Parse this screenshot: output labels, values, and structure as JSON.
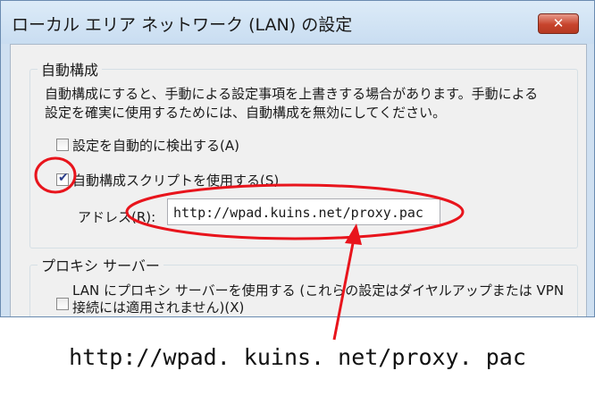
{
  "window": {
    "title": "ローカル エリア ネットワーク (LAN) の設定",
    "close_glyph": "✕"
  },
  "auto_config": {
    "legend": "自動構成",
    "description_line1": "自動構成にすると、手動による設定事項を上書きする場合があります。手動による",
    "description_line2": "設定を確実に使用するためには、自動構成を無効にしてください。",
    "auto_detect": {
      "label": "設定を自動的に検出する(A)",
      "checked": false
    },
    "use_script": {
      "label": "自動構成スクリプトを使用する(S)",
      "checked": true,
      "checkmark": "✔"
    },
    "address": {
      "label": "アドレス(R):",
      "value": "http://wpad.kuins.net/proxy.pac"
    }
  },
  "proxy_server": {
    "legend": "プロキシ サーバー",
    "use_proxy_line1": "LAN にプロキシ サーバーを使用する (これらの設定はダイヤルアップまたは VPN",
    "use_proxy_line2": "接続には適用されません)(X)",
    "checked": false
  },
  "annotation": {
    "color": "#e8141c",
    "caption": "http://wpad. kuins. net/proxy. pac"
  }
}
